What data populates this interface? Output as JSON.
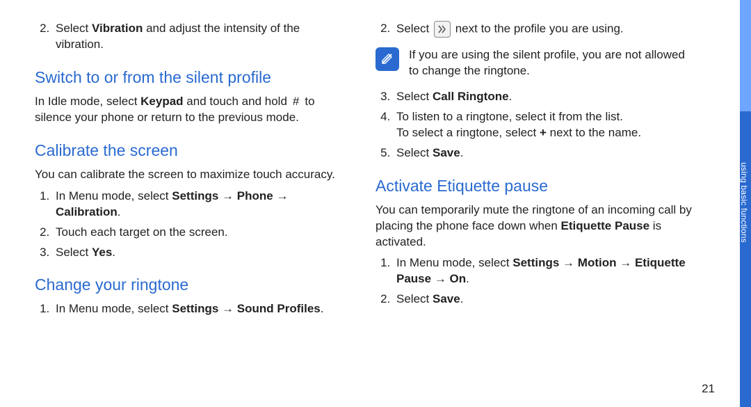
{
  "pageNumber": "21",
  "sideTabLabel": "using basic functions",
  "left": {
    "vibrationStep": {
      "num": "2.",
      "pre": "Select ",
      "bold": "Vibration",
      "post": " and adjust the intensity of the vibration."
    },
    "silent": {
      "heading": "Switch to or from the silent profile",
      "para_pre": "In Idle mode, select ",
      "para_bold": "Keypad",
      "para_mid": " and touch and hold ",
      "para_post": " to silence your phone or return to the previous mode.",
      "poundGlyph": "#"
    },
    "calibrate": {
      "heading": "Calibrate the screen",
      "intro": "You can calibrate the screen to maximize touch accuracy.",
      "s1_pre": "In Menu mode, select ",
      "s1_b1": "Settings",
      "s1_arrow1": " → ",
      "s1_b2": "Phone",
      "s1_arrow2": " → ",
      "s1_b3": "Calibration",
      "s1_post": ".",
      "s2": "Touch each target on the screen.",
      "s3_pre": "Select ",
      "s3_bold": "Yes",
      "s3_post": "."
    },
    "ringtone": {
      "heading": "Change your ringtone",
      "s1_pre": "In Menu mode, select ",
      "s1_b1": "Settings",
      "s1_arrow": " → ",
      "s1_b2": "Sound Profiles",
      "s1_post": "."
    }
  },
  "right": {
    "step2": {
      "num": "2.",
      "pre": "Select ",
      "post": " next to the profile you are using."
    },
    "note": {
      "text": "If you are using the silent profile, you are not allowed to change the ringtone."
    },
    "step3": {
      "pre": "Select ",
      "bold": "Call Ringtone",
      "post": "."
    },
    "step4": {
      "line1": "To listen to a ringtone, select it from the list.",
      "line2_pre": "To select a ringtone, select ",
      "line2_bold": "+",
      "line2_post": " next to the name."
    },
    "step5": {
      "pre": "Select ",
      "bold": "Save",
      "post": "."
    },
    "etiquette": {
      "heading": "Activate Etiquette pause",
      "intro_pre": "You can temporarily mute the ringtone of an incoming call by placing the phone face down when ",
      "intro_bold": "Etiquette Pause",
      "intro_post": " is activated.",
      "s1_pre": "In Menu mode, select ",
      "s1_b1": "Settings",
      "s1_a1": " → ",
      "s1_b2": "Motion",
      "s1_a2": " → ",
      "s1_b3": "Etiquette Pause",
      "s1_a3": " → ",
      "s1_b4": "On",
      "s1_post": ".",
      "s2_pre": "Select ",
      "s2_bold": "Save",
      "s2_post": "."
    }
  }
}
